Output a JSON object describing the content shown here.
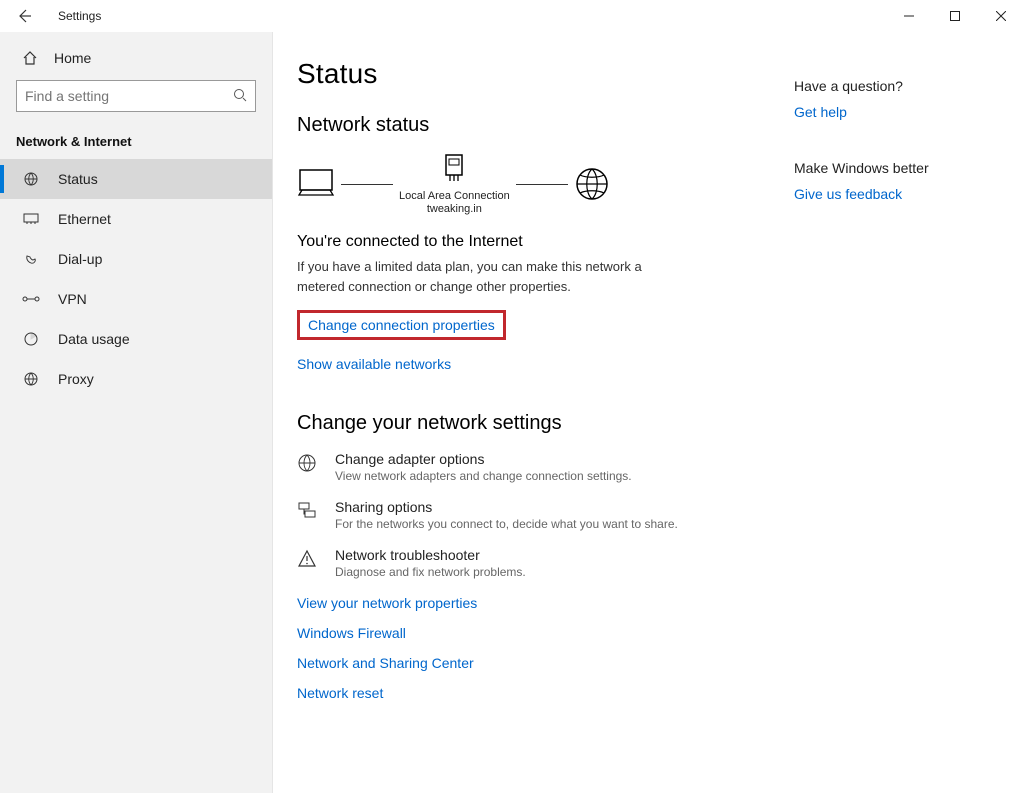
{
  "window": {
    "title": "Settings"
  },
  "sidebar": {
    "home": "Home",
    "search_placeholder": "Find a setting",
    "category": "Network & Internet",
    "items": [
      {
        "label": "Status"
      },
      {
        "label": "Ethernet"
      },
      {
        "label": "Dial-up"
      },
      {
        "label": "VPN"
      },
      {
        "label": "Data usage"
      },
      {
        "label": "Proxy"
      }
    ]
  },
  "page": {
    "title": "Status",
    "network_status": "Network status",
    "diagram": {
      "conn_name": "Local Area Connection",
      "conn_domain": "tweaking.in"
    },
    "connected_title": "You're connected to the Internet",
    "connected_desc": "If you have a limited data plan, you can make this network a metered connection or change other properties.",
    "change_props": "Change connection properties",
    "show_networks": "Show available networks",
    "change_settings": "Change your network settings",
    "options": [
      {
        "title": "Change adapter options",
        "desc": "View network adapters and change connection settings."
      },
      {
        "title": "Sharing options",
        "desc": "For the networks you connect to, decide what you want to share."
      },
      {
        "title": "Network troubleshooter",
        "desc": "Diagnose and fix network problems."
      }
    ],
    "links": [
      "View your network properties",
      "Windows Firewall",
      "Network and Sharing Center",
      "Network reset"
    ]
  },
  "aside": {
    "q1": "Have a question?",
    "l1": "Get help",
    "q2": "Make Windows better",
    "l2": "Give us feedback"
  }
}
